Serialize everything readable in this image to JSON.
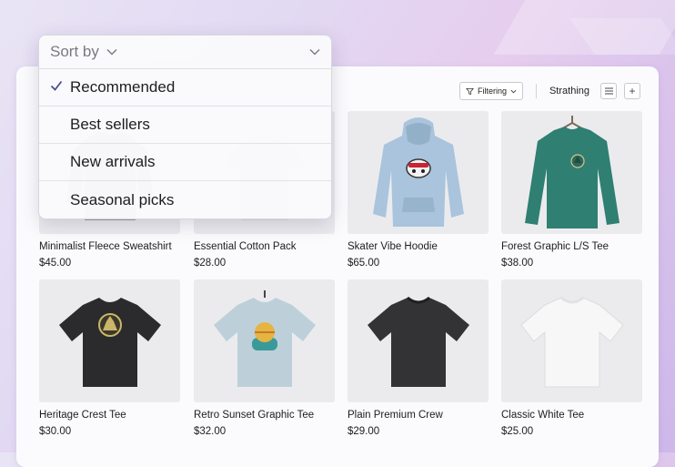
{
  "sort": {
    "label": "Sort by",
    "options": [
      {
        "label": "Recommended",
        "selected": true
      },
      {
        "label": "Best sellers",
        "selected": false
      },
      {
        "label": "New arrivals",
        "selected": false
      },
      {
        "label": "Seasonal picks",
        "selected": false
      }
    ]
  },
  "toolbar": {
    "filter_label": "Filtering",
    "store_name": "Strathing",
    "add_label": "+"
  },
  "products": [
    {
      "name": "Minimalist Fleece Sweatshirt",
      "price": "$45.00",
      "color": "#9a9a9e"
    },
    {
      "name": "Essential Cotton Pack",
      "price": "$28.00",
      "color": "#d6d6d8"
    },
    {
      "name": "Skater Vibe Hoodie",
      "price": "$65.00",
      "color": "#a9c4dc"
    },
    {
      "name": "Forest Graphic L/S Tee",
      "price": "$38.00",
      "color": "#2f7f72"
    },
    {
      "name": "Heritage Crest Tee",
      "price": "$30.00",
      "color": "#2b2b2d"
    },
    {
      "name": "Retro Sunset Graphic Tee",
      "price": "$32.00",
      "color": "#bdd0d9"
    },
    {
      "name": "Plain Premium Crew",
      "price": "$29.00",
      "color": "#333335"
    },
    {
      "name": "Classic White Tee",
      "price": "$25.00",
      "color": "#f4f4f4"
    }
  ],
  "colors": {
    "accent": "#4a4f8f",
    "panel": "#fbfbfd"
  }
}
